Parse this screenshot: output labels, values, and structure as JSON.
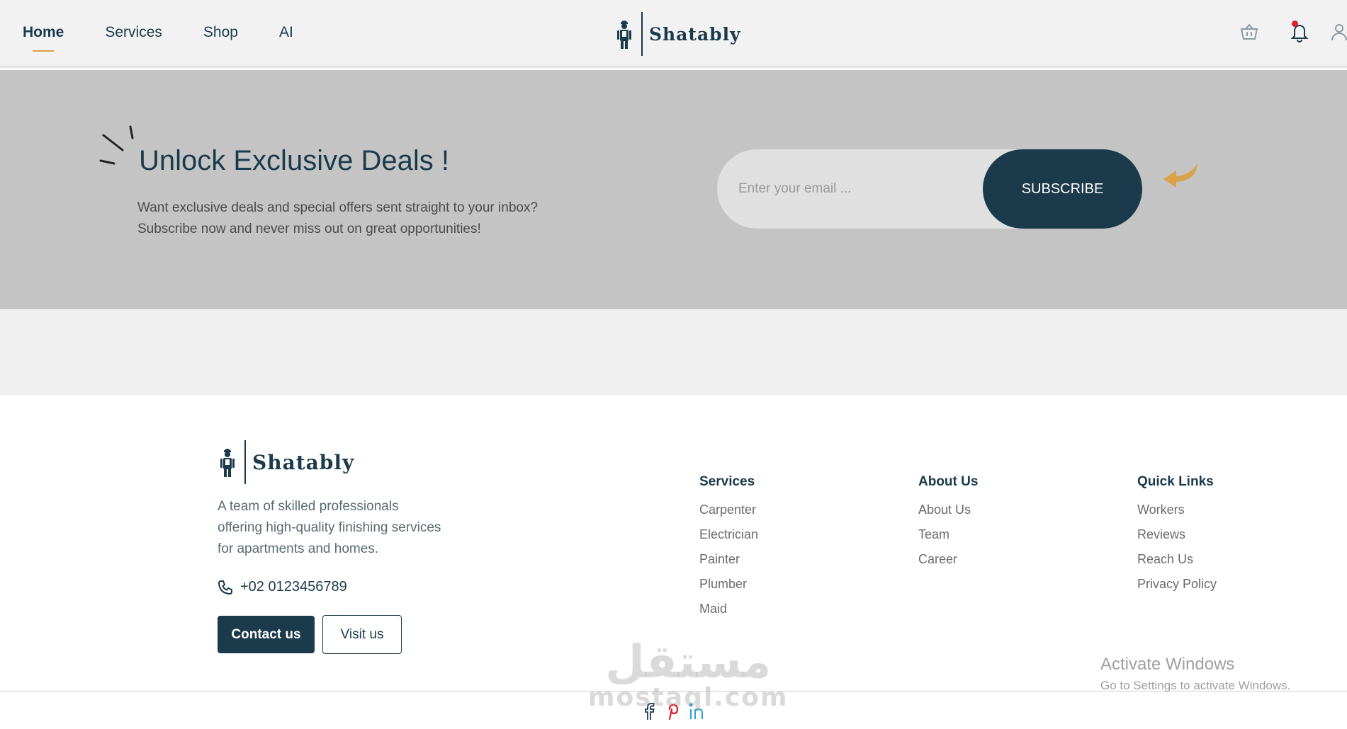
{
  "header": {
    "nav": [
      {
        "label": "Home",
        "active": true
      },
      {
        "label": "Services",
        "active": false
      },
      {
        "label": "Shop",
        "active": false
      },
      {
        "label": "AI",
        "active": false
      }
    ],
    "brand": "Shatably",
    "icons": [
      "basket-icon",
      "bell-icon",
      "user-icon"
    ]
  },
  "banner": {
    "title": "Unlock Exclusive Deals !",
    "text_line1": "Want exclusive deals and special offers sent straight to your inbox?",
    "text_line2": "Subscribe now and never miss out on great opportunities!",
    "email_placeholder": "Enter your email ...",
    "subscribe_label": "SUBSCRIBE"
  },
  "footer": {
    "brand": "Shatably",
    "description": "A team of skilled professionals offering high-quality finishing services for apartments and homes.",
    "phone": "+02 0123456789",
    "contact_label": "Contact us",
    "visit_label": "Visit us",
    "columns": [
      {
        "title": "Services",
        "links": [
          "Carpenter",
          "Electrician",
          "Painter",
          "Plumber",
          "Maid"
        ]
      },
      {
        "title": "About Us",
        "links": [
          "About Us",
          "Team",
          "Career"
        ]
      },
      {
        "title": "Quick Links",
        "links": [
          "Workers",
          "Reviews",
          "Reach Us",
          "Privacy Policy"
        ]
      }
    ],
    "social": [
      "facebook-icon",
      "pinterest-icon",
      "linkedin-icon"
    ]
  },
  "overlay": {
    "watermark_arabic": "مستقل",
    "watermark_latin": "mostaql.com",
    "activate_title": "Activate Windows",
    "activate_sub": "Go to Settings to activate Windows."
  },
  "colors": {
    "primary": "#1b3a4b",
    "accent": "#d9a24a",
    "banner_bg": "#c4c4c4",
    "notification": "#e01e2b"
  }
}
